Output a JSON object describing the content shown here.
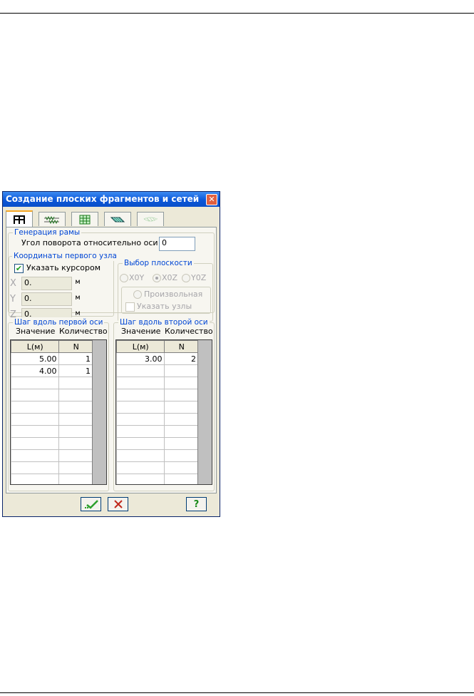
{
  "window": {
    "title": "Создание плоских фрагментов и сетей",
    "close": "✕"
  },
  "tabs": [
    {
      "icon": "frame-icon",
      "active": true
    },
    {
      "icon": "spring-icon",
      "active": false
    },
    {
      "icon": "grid-icon",
      "active": false
    },
    {
      "icon": "plate-mesh-icon",
      "active": false
    },
    {
      "icon": "surface-mesh-icon",
      "active": false
    }
  ],
  "frame_generation": {
    "group_label": "Генерация рамы",
    "rotation_label": "Угол поворота относительно оси Z",
    "rotation_value": "0"
  },
  "first_node": {
    "group_label": "Координаты первого узла",
    "cursor_checkbox_label": "Указать курсором",
    "cursor_checked": true,
    "x_label": "X",
    "x_value": "0.",
    "x_unit": "м",
    "y_label": "Y",
    "y_value": "0.",
    "y_unit": "м",
    "z_label": "Z",
    "z_value": "0.",
    "z_unit": "м"
  },
  "plane": {
    "group_label": "Выбор плоскости",
    "options": [
      "X0Y",
      "X0Z",
      "Y0Z"
    ],
    "selected": "X0Z",
    "arbitrary_label": "Произвольная",
    "nodes_checkbox_label": "Указать узлы"
  },
  "axis1": {
    "group_label": "Шаг вдоль первой оси",
    "value_header": "Значение",
    "count_header": "Количество",
    "col_length": "L(м)",
    "col_n": "N",
    "rows": [
      [
        "5.00",
        "1"
      ],
      [
        "4.00",
        "1"
      ]
    ]
  },
  "axis2": {
    "group_label": "Шаг вдоль второй оси",
    "value_header": "Значение",
    "count_header": "Количество",
    "col_length": "L(м)",
    "col_n": "N",
    "rows": [
      [
        "3.00",
        "2"
      ]
    ]
  },
  "buttons": {
    "ok_icon": "check-icon",
    "cancel_icon": "cross-icon",
    "help_label": "?"
  },
  "colors": {
    "title_bar": "#0b57d8",
    "group_label": "#0046d5",
    "ok_green": "#2ca02c",
    "cancel_red": "#c0281c"
  }
}
